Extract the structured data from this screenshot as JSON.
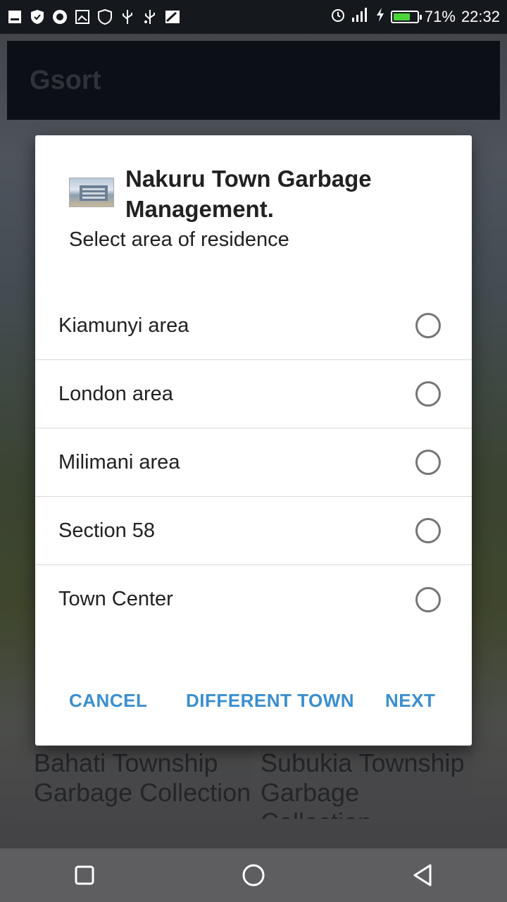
{
  "status_bar": {
    "battery_percent_text": "71%",
    "battery_level": 0.71,
    "time": "22:32",
    "left_icons": [
      "notification-icon",
      "shield-icon",
      "app-icon",
      "screenshot-icon",
      "security-icon",
      "usb-icon",
      "usb-debug-icon",
      "image-icon"
    ],
    "right_icons": [
      "alarm-icon",
      "signal-icon",
      "charging-icon",
      "battery-icon"
    ],
    "battery_color": "#4cd43b"
  },
  "app": {
    "title": "Gsort",
    "cards": [
      {
        "label": "Bahati Township Garbage Collection"
      },
      {
        "label": "Subukia Township Garbage Collection"
      }
    ]
  },
  "dialog": {
    "title": "Nakuru Town Garbage Management.",
    "subtitle": "Select area of residence",
    "options": [
      {
        "label": "Kiamunyi area",
        "selected": false
      },
      {
        "label": "London area",
        "selected": false
      },
      {
        "label": "Milimani area",
        "selected": false
      },
      {
        "label": "Section 58",
        "selected": false
      },
      {
        "label": "Town Center",
        "selected": false
      }
    ],
    "buttons": {
      "cancel": "CANCEL",
      "different_town": "DIFFERENT TOWN",
      "next": "NEXT"
    },
    "accent_color": "#3b8fd0"
  },
  "nav_bar": {
    "buttons": [
      "recent-apps-icon",
      "home-icon",
      "back-icon"
    ]
  }
}
